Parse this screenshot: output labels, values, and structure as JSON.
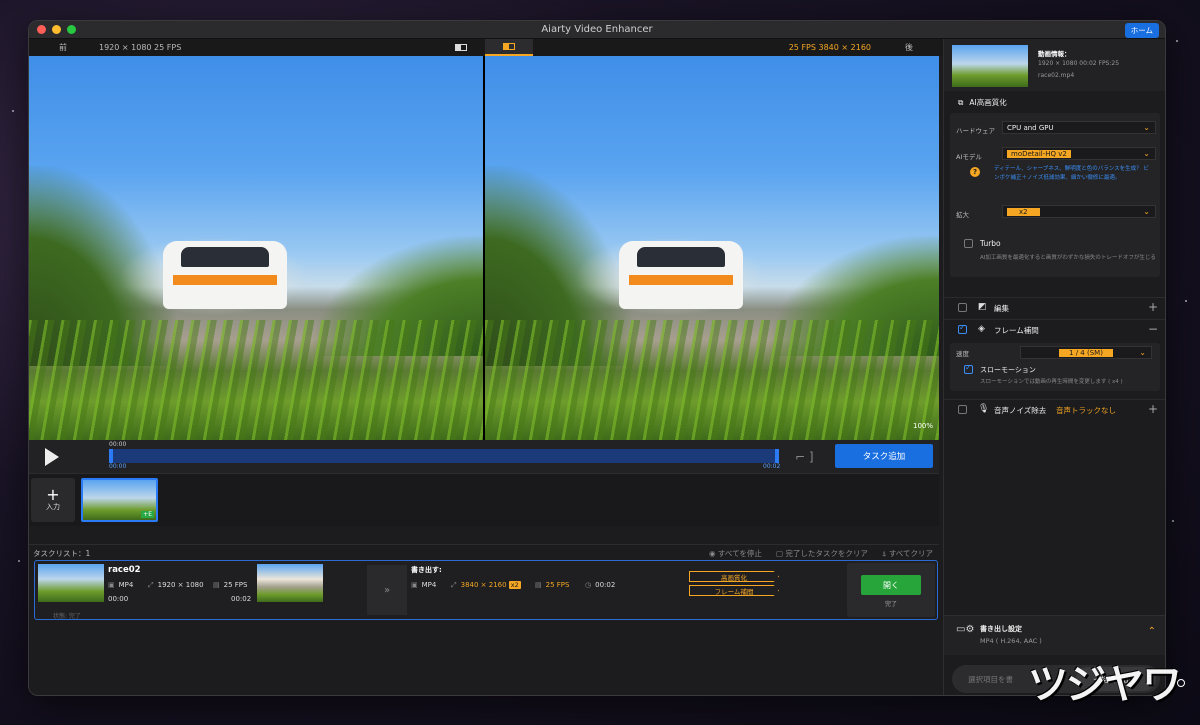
{
  "window": {
    "title": "Aiarty Video Enhancer",
    "home_label": "ホーム"
  },
  "compare": {
    "before_label": "前",
    "before_info": "1920 × 1080   25 FPS",
    "after_info": "25 FPS   3840 × 2160",
    "after_label": "後",
    "zoom": "100%"
  },
  "player": {
    "time_top": "00:00",
    "time_start": "00:00",
    "time_end": "00:02",
    "add_task_label": "タスク追加"
  },
  "thumbs": {
    "input_label": "入力",
    "badge": "+E"
  },
  "tasklist": {
    "header": "タスクリスト：1",
    "stop_all": "すべてを停止",
    "clear_done": "完了したタスクをクリア",
    "clear_all": "すべてクリア"
  },
  "task": {
    "name": "race02",
    "format": "MP4",
    "resolution": "1920 × 1080",
    "fps": "25 FPS",
    "start": "00:00",
    "end": "00:02",
    "status": "状態: 完了",
    "export_label": "書き出す:",
    "out_format": "MP4",
    "out_resolution": "3840 × 2160",
    "out_scale": "x2",
    "out_fps": "25 FPS",
    "out_duration": "00:02",
    "tag1": "高画質化",
    "tag2": "フレーム補間",
    "open_label": "開く",
    "done_label": "完了"
  },
  "info": {
    "title": "動画情報：",
    "meta": "1920 × 1080 00:02 FPS:25",
    "file": "race02.mp4"
  },
  "enhance": {
    "section_title": "AI高画質化",
    "hw_label": "ハードウェア",
    "hw_value": "CPU and GPU",
    "model_label": "AIモデル",
    "model_value": "moDetail-HQ  v2",
    "model_help": "ディテール、シャープネス、鮮明度と色のバランスを生成？ ビンボケ補正＋ノイズ低減効果、細かい微修に最適。",
    "scale_label": "拡大",
    "scale_value": "x2",
    "turbo_label": "Turbo",
    "turbo_help": "AI加工画質を最適化すると画質がわずかな損失のトレードオフが生じる"
  },
  "features": {
    "edit_label": "編集",
    "interp_label": "フレーム補間",
    "speed_label": "速度",
    "speed_value": "1 / 4 (SM)",
    "slowmo_label": "スローモーション",
    "slowmo_help": "スローモーションでは動画の再生時間を変更します ( x4 )",
    "noise_label": "音声ノイズ除去",
    "noise_value": "音声トラックなし"
  },
  "export": {
    "title": "書き出し設定",
    "value": "MP4 ( H.264, AAC )",
    "batch_placeholder": "選択項目を書",
    "batch_label": "一括書き出し"
  },
  "watermark": "ツジヤワ",
  "colors": {
    "accent_blue": "#1a6fe0",
    "accent_orange": "#f5a623",
    "open_green": "#27a53a"
  }
}
